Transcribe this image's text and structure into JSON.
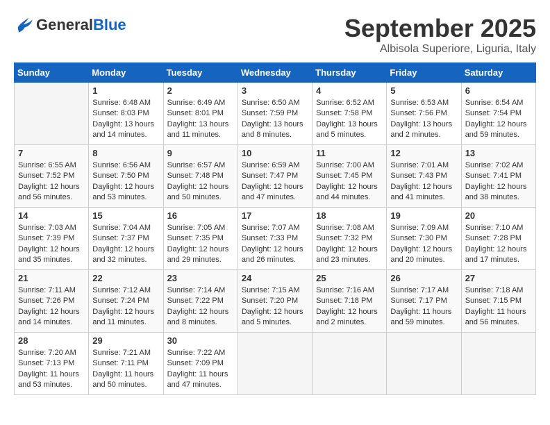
{
  "header": {
    "logo_general": "General",
    "logo_blue": "Blue",
    "month_year": "September 2025",
    "location": "Albisola Superiore, Liguria, Italy"
  },
  "columns": [
    "Sunday",
    "Monday",
    "Tuesday",
    "Wednesday",
    "Thursday",
    "Friday",
    "Saturday"
  ],
  "weeks": [
    [
      {
        "day": "",
        "empty": true
      },
      {
        "day": "1",
        "sunrise": "6:48 AM",
        "sunset": "8:03 PM",
        "daylight": "13 hours and 14 minutes."
      },
      {
        "day": "2",
        "sunrise": "6:49 AM",
        "sunset": "8:01 PM",
        "daylight": "13 hours and 11 minutes."
      },
      {
        "day": "3",
        "sunrise": "6:50 AM",
        "sunset": "7:59 PM",
        "daylight": "13 hours and 8 minutes."
      },
      {
        "day": "4",
        "sunrise": "6:52 AM",
        "sunset": "7:58 PM",
        "daylight": "13 hours and 5 minutes."
      },
      {
        "day": "5",
        "sunrise": "6:53 AM",
        "sunset": "7:56 PM",
        "daylight": "13 hours and 2 minutes."
      },
      {
        "day": "6",
        "sunrise": "6:54 AM",
        "sunset": "7:54 PM",
        "daylight": "12 hours and 59 minutes."
      }
    ],
    [
      {
        "day": "7",
        "sunrise": "6:55 AM",
        "sunset": "7:52 PM",
        "daylight": "12 hours and 56 minutes."
      },
      {
        "day": "8",
        "sunrise": "6:56 AM",
        "sunset": "7:50 PM",
        "daylight": "12 hours and 53 minutes."
      },
      {
        "day": "9",
        "sunrise": "6:57 AM",
        "sunset": "7:48 PM",
        "daylight": "12 hours and 50 minutes."
      },
      {
        "day": "10",
        "sunrise": "6:59 AM",
        "sunset": "7:47 PM",
        "daylight": "12 hours and 47 minutes."
      },
      {
        "day": "11",
        "sunrise": "7:00 AM",
        "sunset": "7:45 PM",
        "daylight": "12 hours and 44 minutes."
      },
      {
        "day": "12",
        "sunrise": "7:01 AM",
        "sunset": "7:43 PM",
        "daylight": "12 hours and 41 minutes."
      },
      {
        "day": "13",
        "sunrise": "7:02 AM",
        "sunset": "7:41 PM",
        "daylight": "12 hours and 38 minutes."
      }
    ],
    [
      {
        "day": "14",
        "sunrise": "7:03 AM",
        "sunset": "7:39 PM",
        "daylight": "12 hours and 35 minutes."
      },
      {
        "day": "15",
        "sunrise": "7:04 AM",
        "sunset": "7:37 PM",
        "daylight": "12 hours and 32 minutes."
      },
      {
        "day": "16",
        "sunrise": "7:05 AM",
        "sunset": "7:35 PM",
        "daylight": "12 hours and 29 minutes."
      },
      {
        "day": "17",
        "sunrise": "7:07 AM",
        "sunset": "7:33 PM",
        "daylight": "12 hours and 26 minutes."
      },
      {
        "day": "18",
        "sunrise": "7:08 AM",
        "sunset": "7:32 PM",
        "daylight": "12 hours and 23 minutes."
      },
      {
        "day": "19",
        "sunrise": "7:09 AM",
        "sunset": "7:30 PM",
        "daylight": "12 hours and 20 minutes."
      },
      {
        "day": "20",
        "sunrise": "7:10 AM",
        "sunset": "7:28 PM",
        "daylight": "12 hours and 17 minutes."
      }
    ],
    [
      {
        "day": "21",
        "sunrise": "7:11 AM",
        "sunset": "7:26 PM",
        "daylight": "12 hours and 14 minutes."
      },
      {
        "day": "22",
        "sunrise": "7:12 AM",
        "sunset": "7:24 PM",
        "daylight": "12 hours and 11 minutes."
      },
      {
        "day": "23",
        "sunrise": "7:14 AM",
        "sunset": "7:22 PM",
        "daylight": "12 hours and 8 minutes."
      },
      {
        "day": "24",
        "sunrise": "7:15 AM",
        "sunset": "7:20 PM",
        "daylight": "12 hours and 5 minutes."
      },
      {
        "day": "25",
        "sunrise": "7:16 AM",
        "sunset": "7:18 PM",
        "daylight": "12 hours and 2 minutes."
      },
      {
        "day": "26",
        "sunrise": "7:17 AM",
        "sunset": "7:17 PM",
        "daylight": "11 hours and 59 minutes."
      },
      {
        "day": "27",
        "sunrise": "7:18 AM",
        "sunset": "7:15 PM",
        "daylight": "11 hours and 56 minutes."
      }
    ],
    [
      {
        "day": "28",
        "sunrise": "7:20 AM",
        "sunset": "7:13 PM",
        "daylight": "11 hours and 53 minutes."
      },
      {
        "day": "29",
        "sunrise": "7:21 AM",
        "sunset": "7:11 PM",
        "daylight": "11 hours and 50 minutes."
      },
      {
        "day": "30",
        "sunrise": "7:22 AM",
        "sunset": "7:09 PM",
        "daylight": "11 hours and 47 minutes."
      },
      {
        "day": "",
        "empty": true
      },
      {
        "day": "",
        "empty": true
      },
      {
        "day": "",
        "empty": true
      },
      {
        "day": "",
        "empty": true
      }
    ]
  ],
  "labels": {
    "sunrise": "Sunrise:",
    "sunset": "Sunset:",
    "daylight": "Daylight:"
  }
}
